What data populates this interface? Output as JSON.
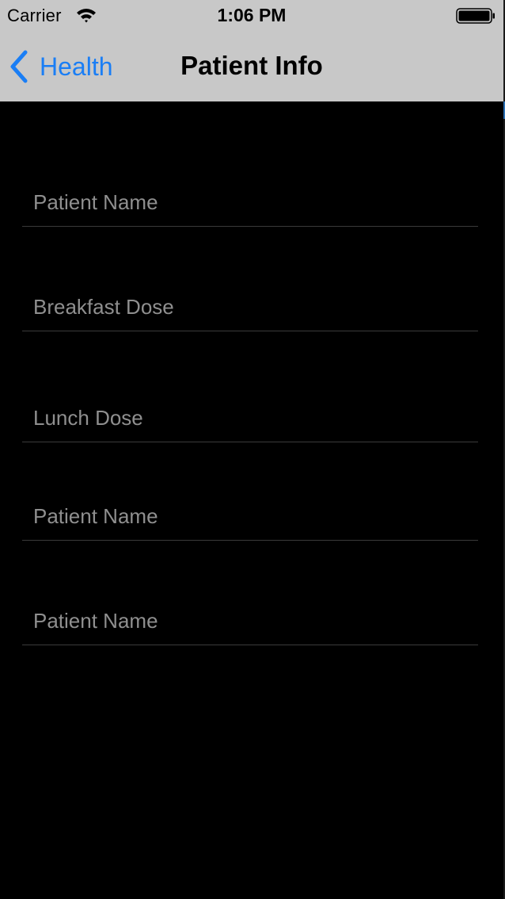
{
  "status_bar": {
    "carrier": "Carrier",
    "time": "1:06 PM",
    "wifi_icon": "wifi-icon",
    "battery_icon": "battery-icon"
  },
  "nav_bar": {
    "back_label": "Health",
    "back_icon": "chevron-left-icon",
    "title": "Patient Info",
    "tint_color": "#1a7ef5",
    "background_color": "#c8c8c8"
  },
  "form": {
    "background_color": "#000000",
    "fields": [
      {
        "placeholder": "Patient Name",
        "value": ""
      },
      {
        "placeholder": "Breakfast Dose",
        "value": ""
      },
      {
        "placeholder": "Lunch Dose",
        "value": ""
      },
      {
        "placeholder": "Patient Name",
        "value": ""
      },
      {
        "placeholder": "Patient Name",
        "value": ""
      }
    ]
  }
}
